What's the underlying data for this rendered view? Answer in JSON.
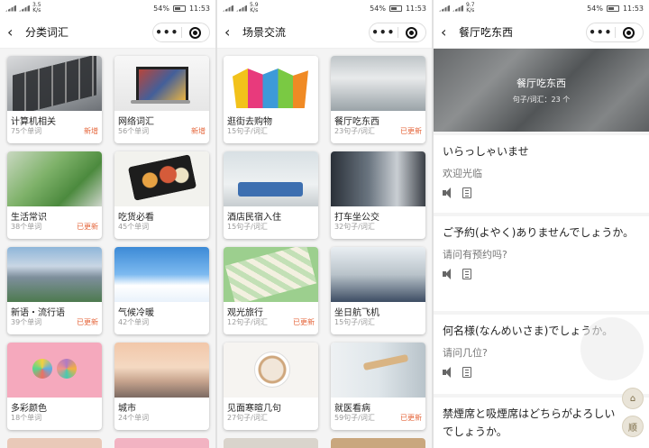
{
  "status": {
    "net1": "3.5",
    "net2": "5.9",
    "net3": "9.7",
    "unit": "K/s",
    "battery": "54%",
    "time": "11:53"
  },
  "screen1": {
    "title": "分类词汇",
    "cards": [
      {
        "title": "计算机相关",
        "count": "75个单词",
        "badge": "新增"
      },
      {
        "title": "网络词汇",
        "count": "56个单词",
        "badge": "新增"
      },
      {
        "title": "生活常识",
        "count": "38个单词",
        "badge": "已更新"
      },
      {
        "title": "吃货必看",
        "count": "45个单词",
        "badge": ""
      },
      {
        "title": "新语・流行语",
        "count": "39个单词",
        "badge": "已更新"
      },
      {
        "title": "气候冷暖",
        "count": "42个单词",
        "badge": ""
      },
      {
        "title": "多彩颜色",
        "count": "18个单词",
        "badge": ""
      },
      {
        "title": "城市",
        "count": "24个单词",
        "badge": ""
      }
    ]
  },
  "screen2": {
    "title": "场景交流",
    "cards": [
      {
        "title": "逛街去购物",
        "count": "15句子/词汇",
        "badge": ""
      },
      {
        "title": "餐厅吃东西",
        "count": "23句子/词汇",
        "badge": "已更新"
      },
      {
        "title": "酒店民宿入住",
        "count": "15句子/词汇",
        "badge": ""
      },
      {
        "title": "打车坐公交",
        "count": "32句子/词汇",
        "badge": ""
      },
      {
        "title": "观光旅行",
        "count": "12句子/词汇",
        "badge": "已更新"
      },
      {
        "title": "坐日航飞机",
        "count": "15句子/词汇",
        "badge": ""
      },
      {
        "title": "见面寒暄几句",
        "count": "27句子/词汇",
        "badge": ""
      },
      {
        "title": "就医看病",
        "count": "59句子/词汇",
        "badge": "已更新"
      }
    ]
  },
  "screen3": {
    "title": "餐厅吃东西",
    "hero_title": "餐厅吃东西",
    "hero_sub": "句子/词汇：23 个",
    "phrases": [
      {
        "jp": "いらっしゃいませ",
        "cn": "欢迎光临"
      },
      {
        "jp": "ご予約(よやく)ありませんでしょうか。",
        "cn": "请问有预约吗?"
      },
      {
        "jp": "何名様(なんめいさま)でしょうか。",
        "cn": "请问几位?"
      },
      {
        "jp": "禁煙席と吸煙席はどちらがよろしいでしょうか。",
        "cn": ""
      }
    ],
    "float_top": "⌂",
    "float_bottom": "顺"
  },
  "capsule": {
    "more": "•••"
  },
  "colors": {
    "badge": "#e5663b",
    "meta": "#999999"
  }
}
